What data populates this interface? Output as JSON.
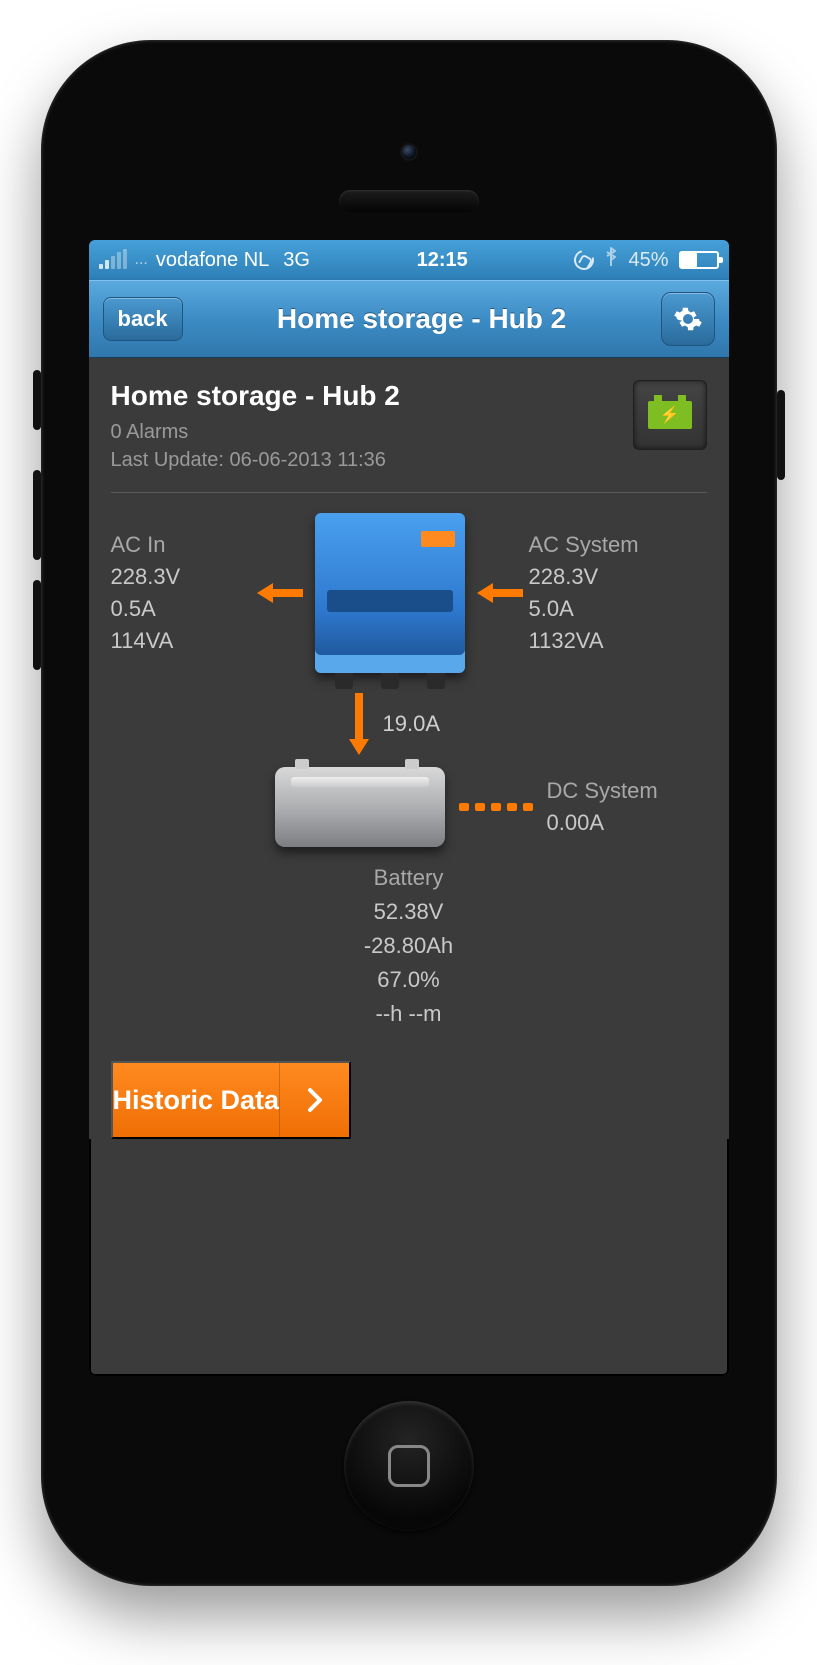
{
  "statusbar": {
    "carrier": "vodafone NL",
    "network": "3G",
    "time": "12:15",
    "battery_pct": "45%"
  },
  "nav": {
    "back_label": "back",
    "title": "Home storage - Hub 2"
  },
  "header": {
    "title": "Home storage - Hub 2",
    "alarms": "0 Alarms",
    "last_update": "Last Update: 06-06-2013 11:36"
  },
  "ac_in": {
    "label": "AC In",
    "voltage": "228.3V",
    "current": "0.5A",
    "power": "114VA"
  },
  "ac_system": {
    "label": "AC System",
    "voltage": "228.3V",
    "current": "5.0A",
    "power": "1132VA"
  },
  "flow": {
    "inverter_to_battery_current": "19.0A"
  },
  "dc_system": {
    "label": "DC System",
    "current": "0.00A"
  },
  "battery": {
    "label": "Battery",
    "voltage": "52.38V",
    "ah": "-28.80Ah",
    "soc": "67.0%",
    "ttg": "--h --m"
  },
  "historic_button": "Historic Data",
  "colors": {
    "accent_orange": "#ff7a00",
    "nav_blue": "#3d8cc5",
    "battery_green": "#7fbe22",
    "bg_dark": "#3b3b3b"
  }
}
